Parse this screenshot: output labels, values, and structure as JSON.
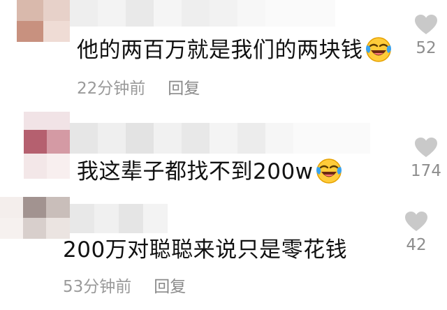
{
  "comments": [
    {
      "text": "他的两百万就是我们的两块钱",
      "emoji": "laughing-crying-emoji",
      "time": "22分钟前",
      "reply": "回复",
      "likes": "52",
      "avatar_color": "#c98f7e"
    },
    {
      "text": "我这辈子都找不到200w",
      "emoji": "laughing-crying-emoji",
      "likes": "174",
      "avatar_color": "#b86576"
    },
    {
      "text": "200万对聪聪来说只是零花钱",
      "time": "53分钟前",
      "reply": "回复",
      "likes": "42",
      "avatar_color": "#9f8e8a"
    }
  ],
  "colors": {
    "heart": "#c9c9c9",
    "meta_text": "#9a9a9a",
    "text": "#111111"
  }
}
